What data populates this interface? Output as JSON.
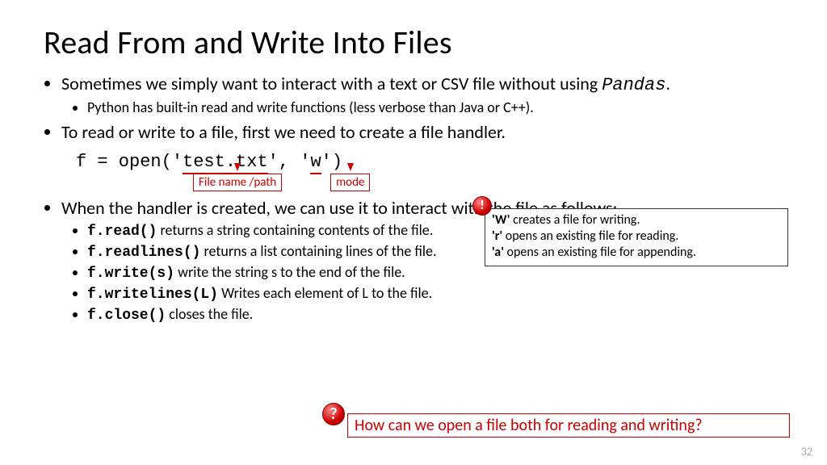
{
  "title": "Read From and Write Into Files",
  "bullets": {
    "b1_pre": "Sometimes we simply want to interact with a text or CSV file without using ",
    "b1_mono": "Pandas",
    "b1_post": ".",
    "b1_sub": "Python has built-in read and write functions (less verbose than Java or C++).",
    "b2": "To read or write to a file, first we need to create a file handler.",
    "code_pre": "f = open(",
    "code_q1": "'",
    "code_fname": "test.txt",
    "code_q2": "', ",
    "code_q3": "'",
    "code_mode": "w",
    "code_q4": "'",
    "code_close": ")",
    "annot_fname": "File name /path",
    "annot_mode": "mode",
    "b3": "When the handler is created, we can use it to interact with the file as follows:",
    "methods": [
      {
        "code": "f.read()",
        "desc": " returns a string containing contents of the file."
      },
      {
        "code": "f.readlines()",
        "desc": "  returns a list containing lines of the file."
      },
      {
        "code": "f.write(s)",
        "desc": "  write the string s to the end of the file."
      },
      {
        "code": "f.writelines(L)",
        "desc": "  Writes each element of L to the file."
      },
      {
        "code": "f.close()",
        "desc": "  closes the file."
      }
    ]
  },
  "info": {
    "w_key": "'W'",
    "w_desc": " creates a file for writing.",
    "r_key": "'r'",
    "r_desc": " opens an existing file for reading.",
    "a_key": "'a'",
    "a_desc": " opens an existing file for appending."
  },
  "question": "How can we open a file both for reading and writing?",
  "pagenum": "32",
  "icons": {
    "excl": "!",
    "qmark": "?"
  }
}
